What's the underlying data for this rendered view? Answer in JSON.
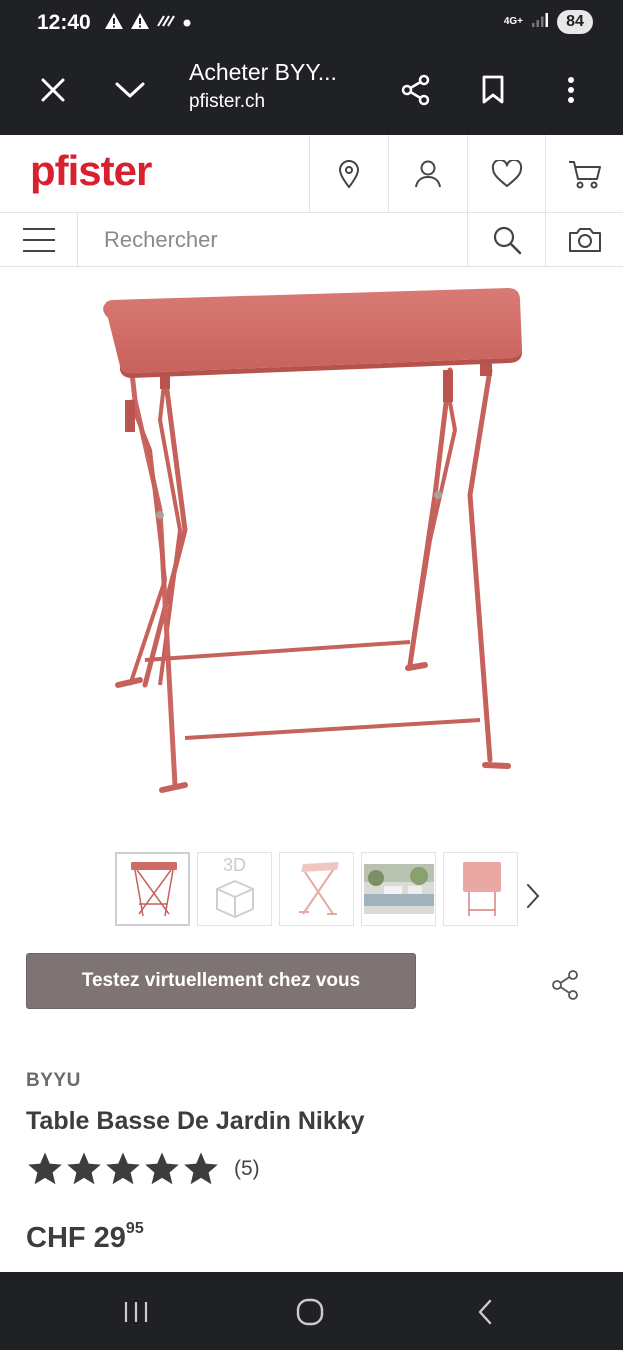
{
  "status_bar": {
    "time": "12:40",
    "network": "4G+",
    "battery": "84"
  },
  "browser": {
    "title": "Acheter BYY...",
    "domain": "pfister.ch"
  },
  "site": {
    "logo_text": "pfister",
    "brand_color": "#d8202e",
    "header_icons": [
      "location-pin-icon",
      "user-icon",
      "heart-icon",
      "cart-icon"
    ]
  },
  "search": {
    "placeholder": "Rechercher"
  },
  "gallery": {
    "thumbnails": [
      "table-photo",
      "3d-view",
      "table-sketch",
      "garden-photo",
      "folded-table"
    ],
    "thumb_3d_label": "3D",
    "active_index": 0
  },
  "actions": {
    "try_virtual_label": "Testez virtuellement chez vous"
  },
  "product": {
    "brand": "BYYU",
    "name": "Table Basse De Jardin Nikky",
    "rating": 5,
    "rating_max": 5,
    "review_count": "(5)",
    "price_main": "CHF 29",
    "price_cents": "95"
  }
}
